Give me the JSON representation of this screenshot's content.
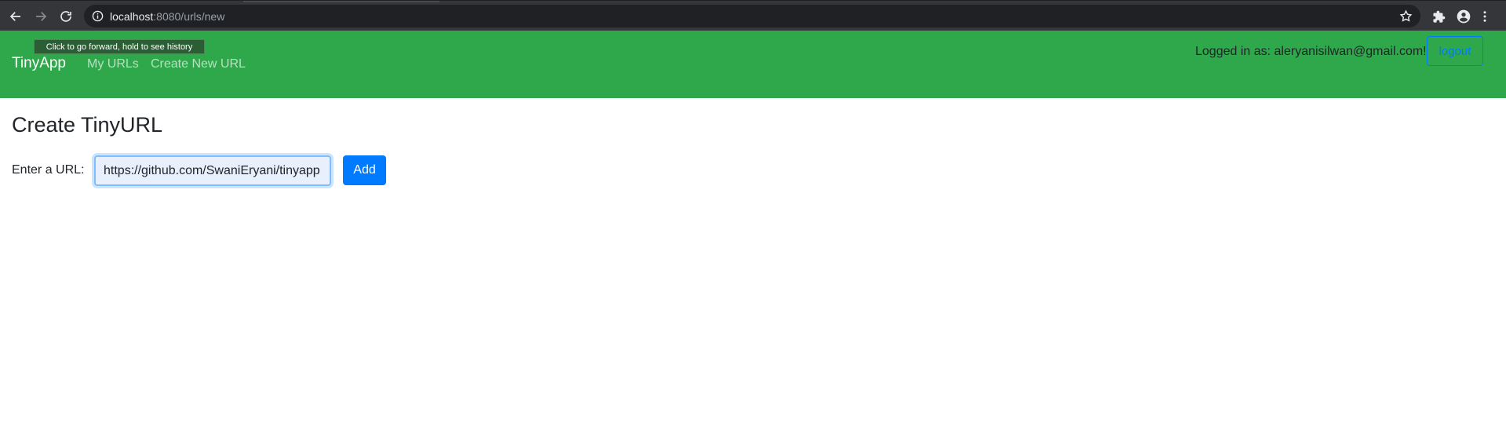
{
  "browser": {
    "url_host": "localhost",
    "url_path": ":8080/urls/new",
    "tooltip": "Click to go forward, hold to see history"
  },
  "navbar": {
    "brand": "TinyApp",
    "links": [
      "My URLs",
      "Create New URL"
    ],
    "logged_in_text": "Logged in as: aleryanisilwan@gmail.com!",
    "logout_label": "logout",
    "background": "#2ea84a"
  },
  "main": {
    "title": "Create TinyURL",
    "url_label": "Enter a URL:",
    "url_value": "https://github.com/SwaniEryani/tinyapp",
    "add_label": "Add",
    "accent": "#007bff"
  },
  "icons": [
    "back-icon",
    "forward-icon",
    "reload-icon",
    "info-icon",
    "star-icon",
    "extensions-icon",
    "profile-icon",
    "menu-icon"
  ]
}
